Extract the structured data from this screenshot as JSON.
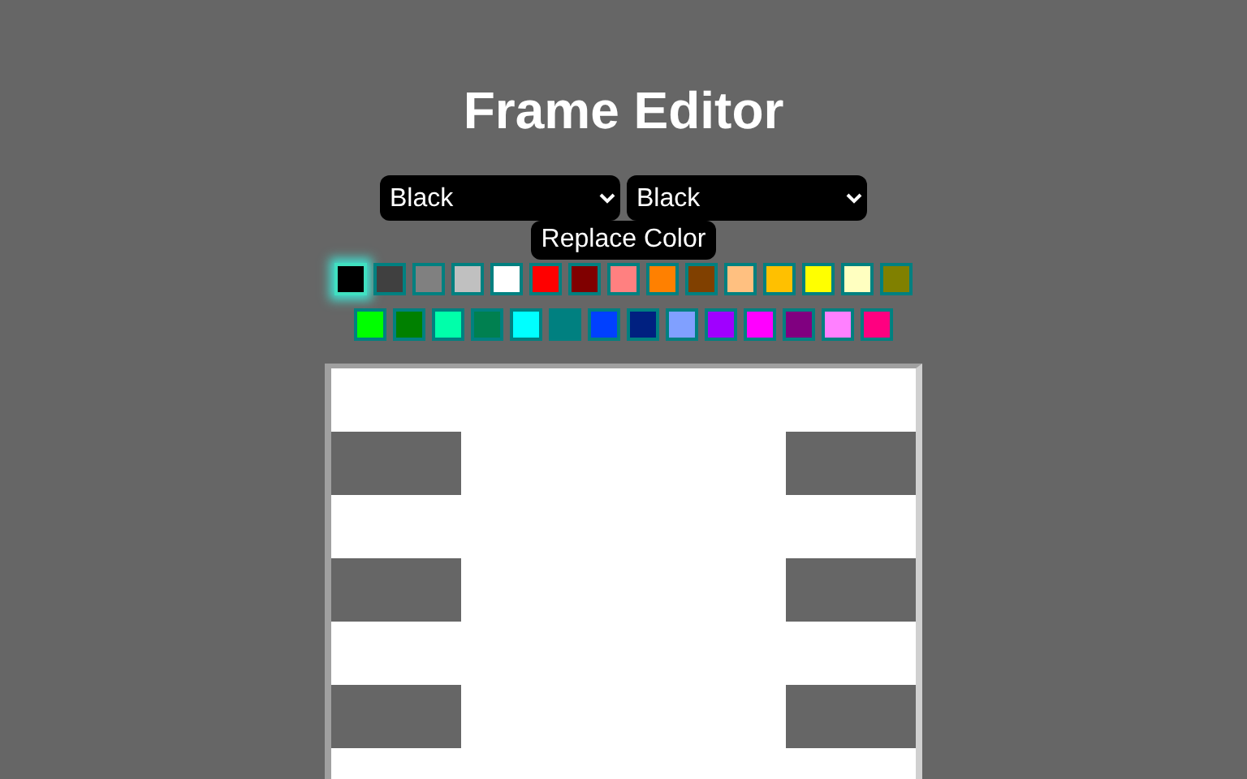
{
  "title": "Frame Editor",
  "from_select": {
    "value": "Black"
  },
  "to_select": {
    "value": "Black"
  },
  "replace_button": "Replace Color",
  "palette_rows": [
    [
      {
        "color": "#000000",
        "selected": true
      },
      {
        "color": "#404040",
        "selected": false
      },
      {
        "color": "#808080",
        "selected": false
      },
      {
        "color": "#c0c0c0",
        "selected": false
      },
      {
        "color": "#ffffff",
        "selected": false
      },
      {
        "color": "#ff0000",
        "selected": false
      },
      {
        "color": "#800000",
        "selected": false
      },
      {
        "color": "#ff8080",
        "selected": false
      },
      {
        "color": "#ff8000",
        "selected": false
      },
      {
        "color": "#804000",
        "selected": false
      },
      {
        "color": "#ffc080",
        "selected": false
      },
      {
        "color": "#ffc000",
        "selected": false
      },
      {
        "color": "#ffff00",
        "selected": false
      },
      {
        "color": "#ffffc0",
        "selected": false
      },
      {
        "color": "#808000",
        "selected": false
      }
    ],
    [
      {
        "color": "#00ff00",
        "selected": false
      },
      {
        "color": "#008000",
        "selected": false
      },
      {
        "color": "#00ffaa",
        "selected": false
      },
      {
        "color": "#008050",
        "selected": false
      },
      {
        "color": "#00ffff",
        "selected": false
      },
      {
        "color": "#008080",
        "selected": false
      },
      {
        "color": "#0040ff",
        "selected": false
      },
      {
        "color": "#002080",
        "selected": false
      },
      {
        "color": "#80a0ff",
        "selected": false
      },
      {
        "color": "#a000ff",
        "selected": false
      },
      {
        "color": "#ff00ff",
        "selected": false
      },
      {
        "color": "#800080",
        "selected": false
      },
      {
        "color": "#ff80ff",
        "selected": false
      },
      {
        "color": "#ff0080",
        "selected": false
      }
    ]
  ]
}
